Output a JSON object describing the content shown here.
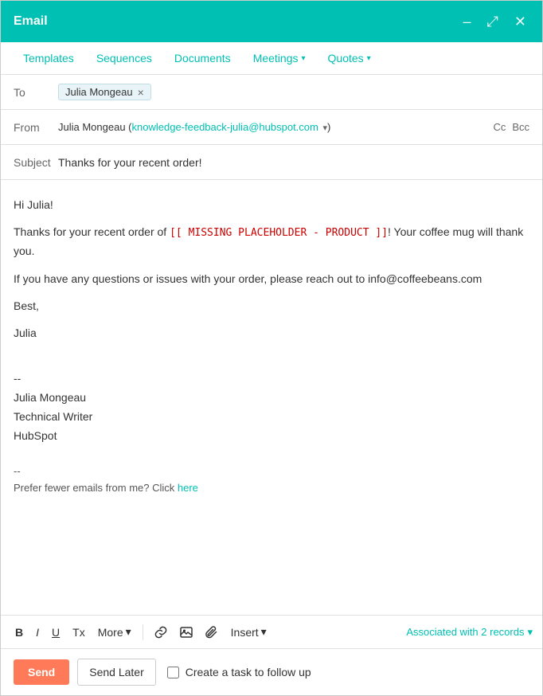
{
  "window": {
    "title": "Email"
  },
  "controls": {
    "minimize_label": "–",
    "expand_label": "⤢",
    "close_label": "✕"
  },
  "nav": {
    "tabs": [
      {
        "id": "templates",
        "label": "Templates"
      },
      {
        "id": "sequences",
        "label": "Sequences"
      },
      {
        "id": "documents",
        "label": "Documents"
      },
      {
        "id": "meetings",
        "label": "Meetings",
        "has_dropdown": true
      },
      {
        "id": "quotes",
        "label": "Quotes",
        "has_dropdown": true
      }
    ]
  },
  "email": {
    "to_label": "To",
    "to_recipient": "Julia Mongeau",
    "to_close": "×",
    "from_label": "From",
    "from_name": "Julia Mongeau",
    "from_email": "knowledge-feedback-julia@hubspot.com",
    "cc_label": "Cc",
    "bcc_label": "Bcc",
    "subject_label": "Subject",
    "subject_value": "Thanks for your recent order!",
    "body_line1": "Hi Julia!",
    "body_line2_prefix": "Thanks for your recent order of ",
    "body_placeholder": "[[ MISSING PLACEHOLDER - PRODUCT ]]",
    "body_line2_suffix": "! Your coffee mug will thank you.",
    "body_line3": "If you have any questions or issues with your order, please reach out to info@coffeebeans.com",
    "body_closing": "Best,",
    "body_name": "Julia",
    "sig_divider": "--",
    "sig_name": "Julia Mongeau",
    "sig_title": "Technical Writer",
    "sig_company": "HubSpot",
    "footer_divider": "--",
    "footer_text_prefix": "Prefer fewer emails from me? Click ",
    "footer_link_text": "here"
  },
  "toolbar": {
    "bold": "B",
    "italic": "I",
    "underline": "U",
    "strikethrough": "Tx",
    "more_label": "More",
    "insert_label": "Insert",
    "associated_label": "Associated with 2 records"
  },
  "bottom_bar": {
    "send_label": "Send",
    "send_later_label": "Send Later",
    "task_checkbox_label": "Create a task to follow up"
  }
}
